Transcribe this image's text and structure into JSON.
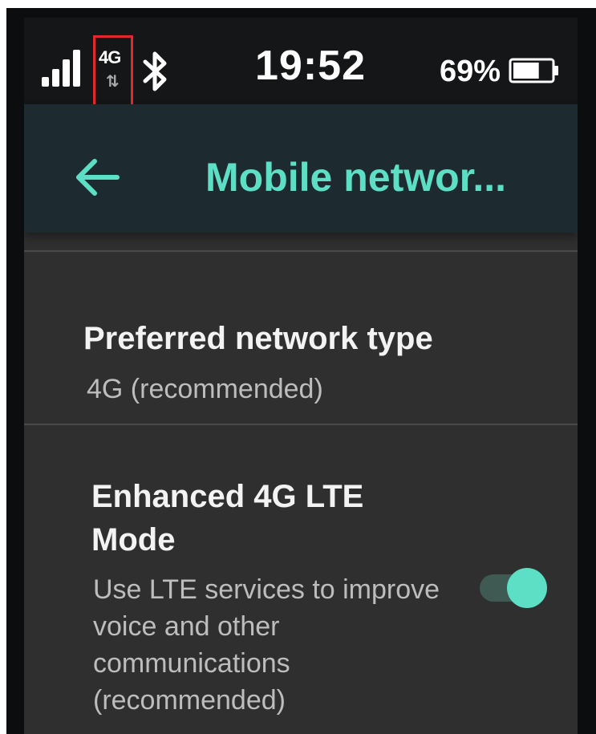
{
  "status_bar": {
    "network_type": "4G",
    "network_activity": "⇅",
    "time": "19:52",
    "battery_percent": "69%",
    "battery_level": 0.69,
    "icons": [
      "signal-strength-icon",
      "bluetooth-icon",
      "battery-icon"
    ]
  },
  "app_bar": {
    "title": "Mobile networ...",
    "back_icon": "arrow-left-icon",
    "accent_color": "#5ddfc6"
  },
  "settings": {
    "preferred_network": {
      "title": "Preferred network type",
      "summary": "4G (recommended)"
    },
    "enhanced_lte": {
      "title": "Enhanced 4G LTE Mode",
      "summary": "Use LTE services to improve voice and other communications (recommended)",
      "enabled": true
    }
  },
  "annotation": {
    "highlight_color": "#e2282c"
  }
}
